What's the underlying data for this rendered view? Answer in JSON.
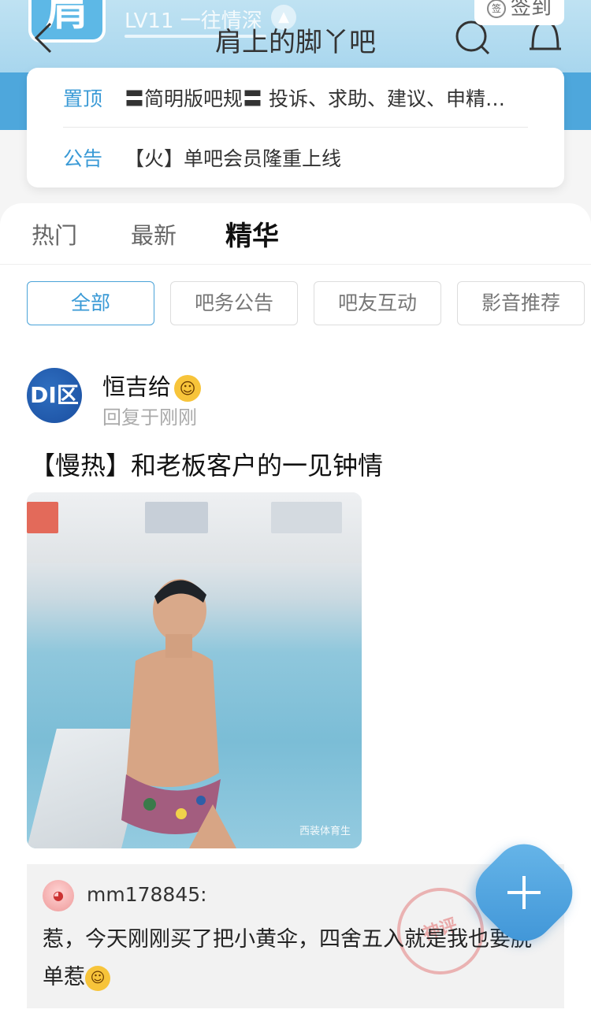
{
  "header": {
    "logo_text": "肩",
    "level_text": "LV11 一往情深",
    "forum_title": "肩上的脚丫吧",
    "signin_label": "签到"
  },
  "notices": [
    {
      "tag": "置顶",
      "text": "〓简明版吧规〓 投诉、求助、建议、申精…"
    },
    {
      "tag": "公告",
      "text": "【火】单吧会员隆重上线"
    }
  ],
  "tabs": [
    {
      "label": "热门"
    },
    {
      "label": "最新"
    },
    {
      "label": "精华"
    }
  ],
  "active_tab": "精华",
  "filters": [
    {
      "label": "全部"
    },
    {
      "label": "吧务公告"
    },
    {
      "label": "吧友互动"
    },
    {
      "label": "影音推荐"
    }
  ],
  "active_filter": "全部",
  "post": {
    "avatar_text": "DI区",
    "author": "恒吉给",
    "reply_time": "回复于刚刚",
    "title": "【慢热】和老板客户的一见钟情",
    "image_watermark": "西装体育生",
    "reply": {
      "user": "mm178845:",
      "text": "惹，今天刚刚买了把小黄伞，四舍五入就是我也要脱单惹",
      "stamp_text": "神评"
    }
  },
  "icons": {
    "back": "back-arrow-icon",
    "search": "search-icon",
    "bell": "bell-icon",
    "fab": "plus-icon"
  },
  "colors": {
    "accent": "#3a9ad6",
    "header_blue": "#4ea7dc"
  }
}
